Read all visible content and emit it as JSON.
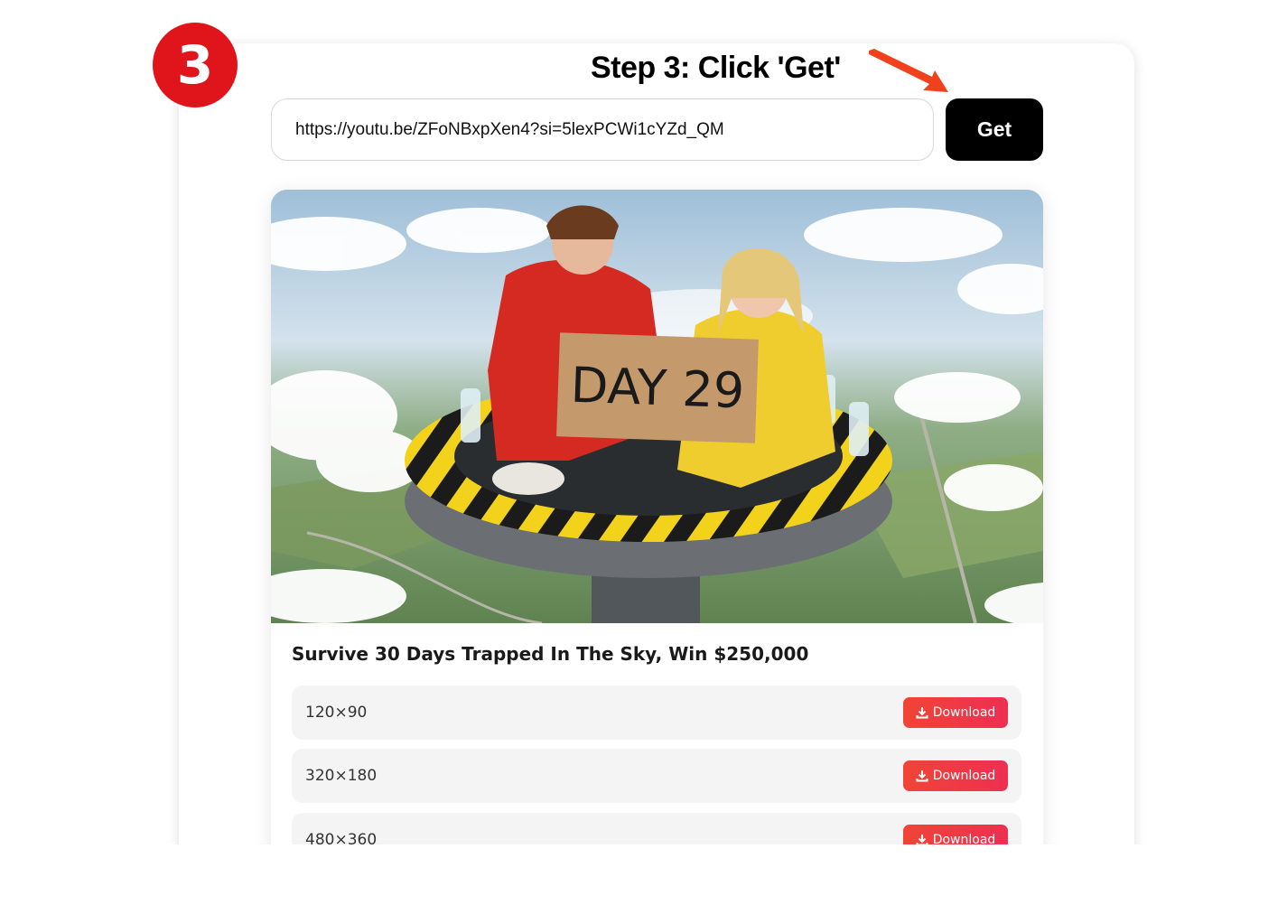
{
  "step": {
    "number": "3",
    "caption": "Step 3: Click 'Get'"
  },
  "form": {
    "url_value": "https://youtu.be/ZFoNBxpXen4?si=5lexPCWi1cYZd_QM",
    "get_label": "Get"
  },
  "video": {
    "title": "Survive 30 Days Trapped In The Sky, Win $250,000",
    "thumbnail_sign": "DAY 29"
  },
  "resolutions": [
    {
      "label": "120×90",
      "button": "Download"
    },
    {
      "label": "320×180",
      "button": "Download"
    },
    {
      "label": "480×360",
      "button": "Download"
    }
  ],
  "colors": {
    "badge": "#e0141b",
    "arrow": "#f0401c",
    "download": "#f14436",
    "get_button": "#000000"
  },
  "icons": {
    "arrow": "arrow-pointer-icon",
    "download": "download-icon"
  }
}
